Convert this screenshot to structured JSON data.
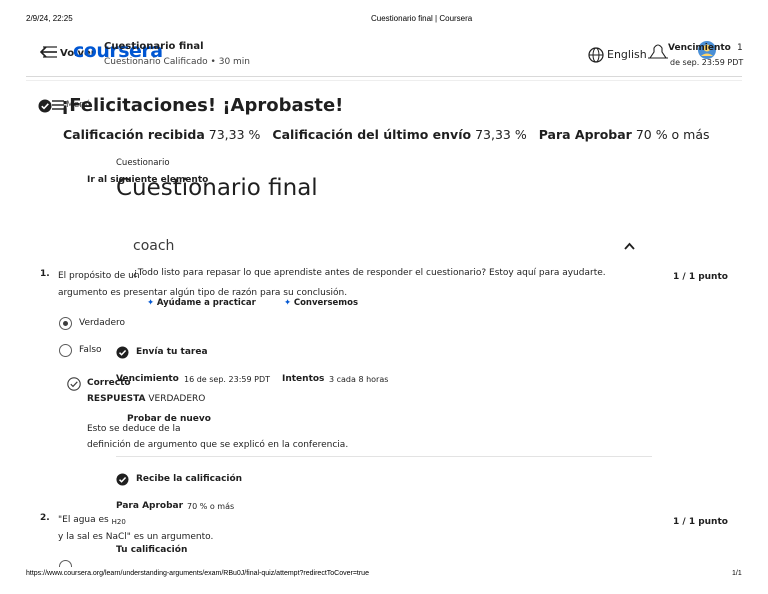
{
  "print_header": {
    "datetime": "2/9/24, 22:25",
    "doc_title": "Cuestionario final | Coursera"
  },
  "print_footer": {
    "url": "https://www.coursera.org/learn/understanding-arguments/exam/RBu0J/final-quiz/attempt?redirectToCover=true",
    "page": "1/1"
  },
  "topbar": {
    "back_label": "Volver",
    "logo": "coursera",
    "quiz_title": "Cuestionario final",
    "quiz_subtitle": "Cuestionario Calificado • 30 min",
    "language": "English",
    "due_label": "Vencimiento",
    "due_day": "1",
    "due_rest": "de sep. 23:59 PDT"
  },
  "result": {
    "menu_label": "Menú",
    "congrats": "¡Felicitaciones! ¡Aprobaste!",
    "grade_label": "Calificación recibida",
    "grade_value": "73,33 %",
    "last_label": "Calificación del último envío",
    "last_value": "73,33 %",
    "pass_label": "Para Aprobar",
    "pass_value": "70 % o más"
  },
  "overlay": {
    "breadcrumb": "Cuestionario",
    "skip_link": "Ir al siguiente elemento",
    "big_title": "Cuestionario final",
    "coach_title": "coach",
    "coach_message": "¿Todo listo para repasar lo que aprendiste antes de responder el cuestionario? Estoy aquí para ayudarte.",
    "coach_btn_practice": "Ayúdame a practicar",
    "coach_btn_chat": "Conversemos",
    "submit_title": "Envía tu tarea",
    "due_label": "Vencimiento",
    "due_value": "16 de sep. 23:59 PDT",
    "attempts_label": "Intentos",
    "attempts_value": "3 cada 8 horas",
    "retry_button": "Probar de nuevo",
    "grade_title": "Recibe la calificación",
    "pass_label": "Para Aprobar",
    "pass_value": "70 % o más",
    "your_grade_label": "Tu calificación"
  },
  "questions": [
    {
      "number": "1.",
      "text_line1": "El propósito de un",
      "text_line2": "argumento es presentar algún tipo de razón para su conclusión.",
      "score": "1 / 1 punto",
      "options": [
        {
          "label": "Verdadero",
          "selected": true
        },
        {
          "label": "Falso",
          "selected": false
        }
      ],
      "feedback_status": "Correcto",
      "answer_label": "RESPUESTA",
      "answer_value": "VERDADERO",
      "explanation_line1": "Esto se deduce de la",
      "explanation_line2": "definición de argumento que se explicó en la conferencia."
    },
    {
      "number": "2.",
      "text_line1": "\"El agua es",
      "text_sub": "H20",
      "text_line2": "y la sal es NaCl\" es un argumento.",
      "score": "1 / 1 punto"
    }
  ],
  "colors": {
    "brand": "#0056d2",
    "text": "#1f1f1f",
    "muted": "#5b5b5b",
    "divider": "#d9d9d9"
  }
}
